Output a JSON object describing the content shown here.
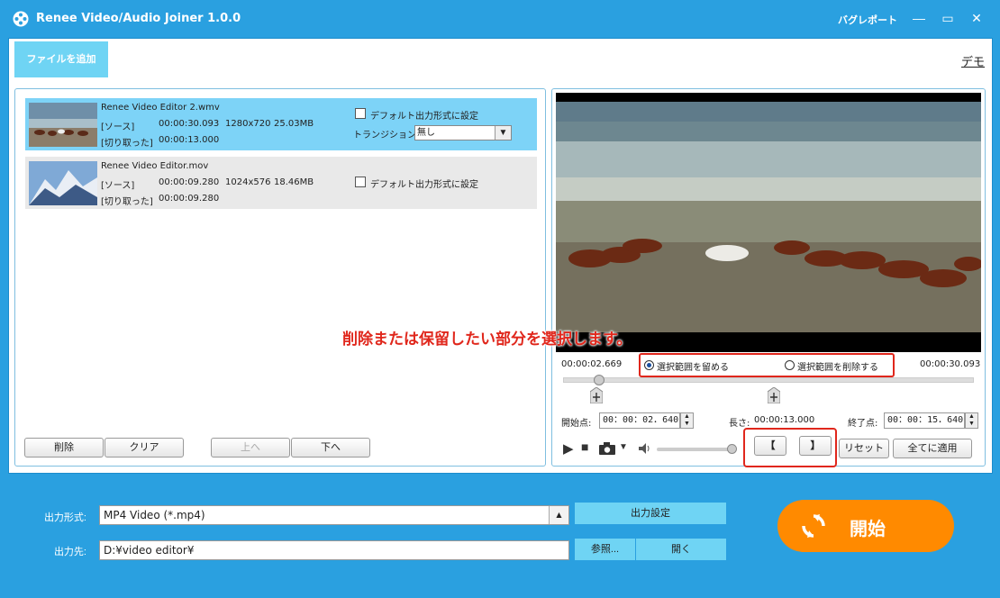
{
  "window": {
    "title": "Renee Video/Audio Joiner 1.0.0",
    "bug_report": "バグレポート",
    "minimize": "—",
    "maximize": "▭",
    "close": "✕"
  },
  "toolbar": {
    "add_file": "ファイルを追加",
    "demo": "デモ"
  },
  "files": [
    {
      "name": "Renee Video Editor 2.wmv",
      "source_label": "[ソース]",
      "source_duration": "00:00:30.093",
      "resolution": "1280x720",
      "size": "25.03MB",
      "cut_label": "[切り取った]",
      "cut_duration": "00:00:13.000",
      "default_format_label": "デフォルト出力形式に設定",
      "transition_label": "トランジション:",
      "transition_value": "無し",
      "selected": true
    },
    {
      "name": "Renee Video Editor.mov",
      "source_label": "[ソース]",
      "source_duration": "00:00:09.280",
      "resolution": "1024x576",
      "size": "18.46MB",
      "cut_label": "[切り取った]",
      "cut_duration": "00:00:09.280",
      "default_format_label": "デフォルト出力形式に設定",
      "selected": false
    }
  ],
  "list_buttons": {
    "delete": "削除",
    "clear": "クリア",
    "up": "上へ",
    "down": "下へ"
  },
  "preview": {
    "current_time": "00:00:02.669",
    "total_time": "00:00:30.093",
    "keep_label": "選択範囲を留める",
    "delete_label": "選択範囲を削除する",
    "keep_selected": true,
    "start_label": "開始点:",
    "start_value": "00：00：02．640",
    "length_label": "長さ:",
    "length_value": "00:00:13.000",
    "end_label": "終了点:",
    "end_value": "00：00：15．640",
    "bracket_open": "【",
    "bracket_close": "】",
    "reset": "リセット",
    "apply_all": "全てに適用",
    "callout": "削除または保留したい部分を選択します。"
  },
  "output": {
    "format_label": "出力形式:",
    "format_value": "MP4 Video (*.mp4)",
    "settings": "出力設定",
    "dest_label": "出力先:",
    "dest_value": "D:¥video editor¥",
    "browse": "参照...",
    "open": "開く"
  },
  "start_button": "開始",
  "colors": {
    "frame": "#2aa0e0",
    "accent_cyan": "#6fd4f4",
    "start_orange": "#ff8a00",
    "highlight_red": "#e0271c"
  }
}
